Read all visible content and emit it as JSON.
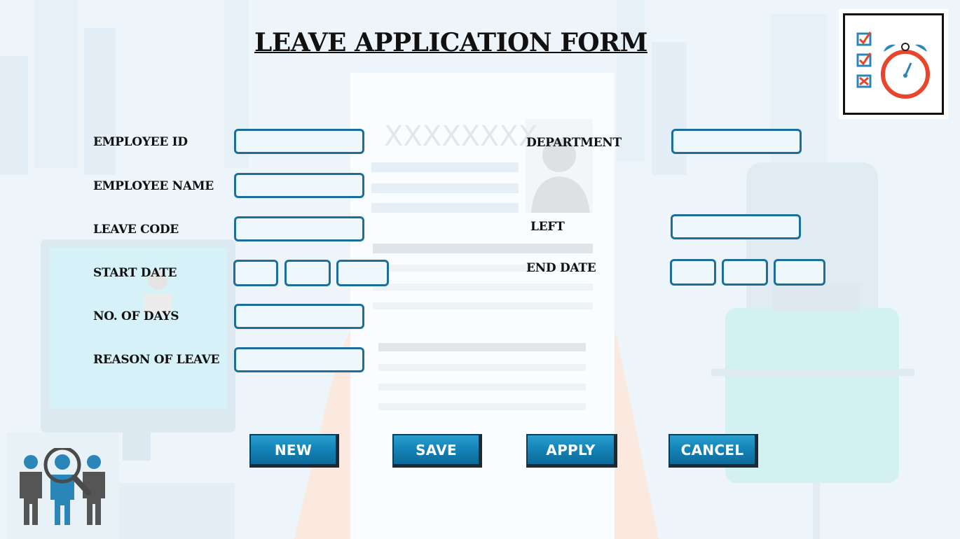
{
  "title": "LEAVE APPLICATION FORM",
  "background": {
    "doc_placeholder": "XXXXXXXX"
  },
  "form": {
    "employee_id": {
      "label": "EMPLOYEE ID",
      "value": ""
    },
    "employee_name": {
      "label": "EMPLOYEE NAME",
      "value": ""
    },
    "leave_code": {
      "label": "LEAVE CODE",
      "value": ""
    },
    "start_date": {
      "label": "START DATE",
      "day": "",
      "month": "",
      "year": ""
    },
    "no_of_days": {
      "label": "NO. OF DAYS",
      "value": ""
    },
    "reason_of_leave": {
      "label": "REASON OF LEAVE",
      "value": ""
    },
    "department": {
      "label": "DEPARTMENT",
      "value": ""
    },
    "left": {
      "label": "LEFT",
      "value": ""
    },
    "end_date": {
      "label": "END DATE",
      "day": "",
      "month": "",
      "year": ""
    }
  },
  "buttons": {
    "new": "NEW",
    "save": "SAVE",
    "apply": "APPLY",
    "cancel": "CANCEL"
  },
  "colors": {
    "field_border": "#1d6f99",
    "button": "#1584b8",
    "accent_red": "#e8452c",
    "icon_blue": "#2a86b8"
  },
  "icons": [
    "checklist-clock-icon",
    "team-search-icon"
  ]
}
